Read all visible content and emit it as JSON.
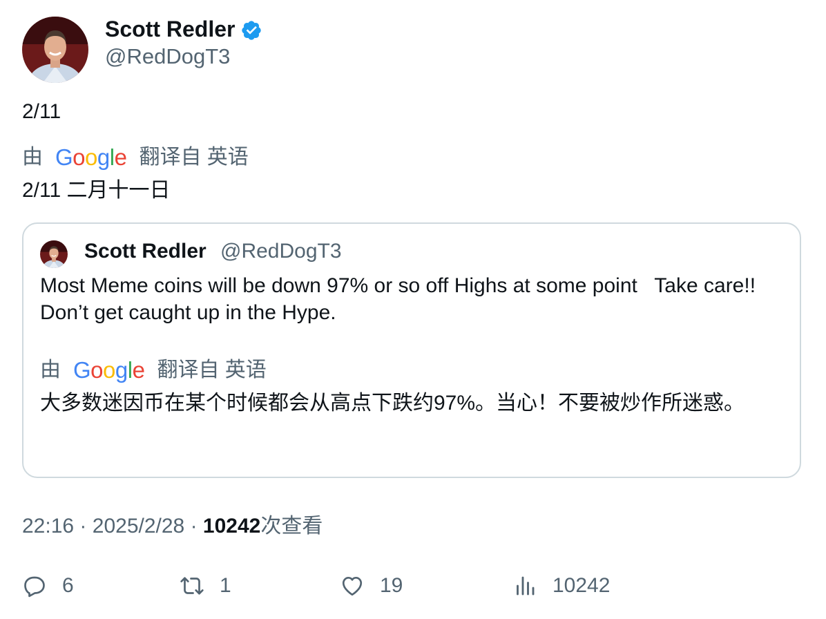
{
  "author": {
    "name": "Scott Redler",
    "handle": "@RedDogT3"
  },
  "tweet": {
    "text": "2/11",
    "translate_by": "由",
    "translate_from": "翻译自 英语",
    "translated_text": "2/11 二月十一日"
  },
  "quote": {
    "name": "Scott Redler",
    "handle": "@RedDogT3",
    "text": "Most Meme coins will be down 97% or so off Highs at some point   Take care!!  Don’t get caught up in the Hype.",
    "translate_by": "由",
    "translate_from": "翻译自 英语",
    "translated_text": "大多数迷因币在某个时候都会从高点下跌约97%。当心！不要被炒作所迷惑。"
  },
  "meta": {
    "time": "22:16",
    "date": "2025/2/28",
    "separator": "·",
    "views": "10242",
    "views_suffix": "次查看"
  },
  "actions": {
    "replies": "6",
    "retweets": "1",
    "likes": "19",
    "views": "10242"
  },
  "colors": {
    "verified": "#1d9bf0",
    "secondary_text": "#536471",
    "border": "#cfd9de",
    "google_blue": "#4285f4",
    "google_red": "#ea4335",
    "google_yellow": "#fbbc05",
    "google_green": "#34a853"
  },
  "google_logo": [
    "G",
    "o",
    "o",
    "g",
    "l",
    "e"
  ]
}
